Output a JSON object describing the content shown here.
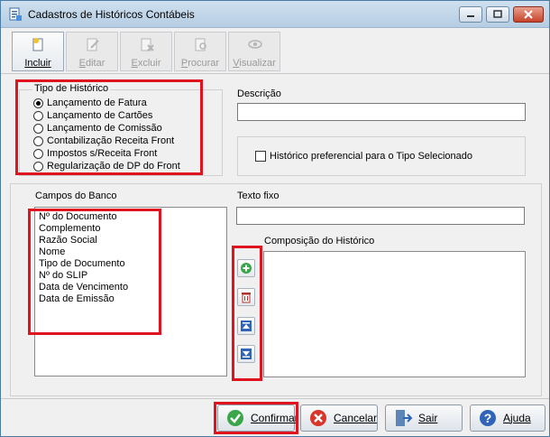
{
  "window": {
    "title": "Cadastros de Históricos Contábeis"
  },
  "toolbar": {
    "buttons": [
      {
        "label": "Incluir",
        "enabled": true,
        "icon": "new-document-icon"
      },
      {
        "label": "Editar",
        "enabled": false,
        "icon": "edit-icon"
      },
      {
        "label": "Excluir",
        "enabled": false,
        "icon": "delete-document-icon"
      },
      {
        "label": "Procurar",
        "enabled": false,
        "icon": "search-document-icon"
      },
      {
        "label": "Visualizar",
        "enabled": false,
        "icon": "eye-icon"
      }
    ]
  },
  "tipo_historico": {
    "legend": "Tipo de Histórico",
    "options": [
      {
        "label": "Lançamento de Fatura",
        "checked": true
      },
      {
        "label": "Lançamento de Cartões",
        "checked": false
      },
      {
        "label": "Lançamento de Comissão",
        "checked": false
      },
      {
        "label": "Contabilização Receita Front",
        "checked": false
      },
      {
        "label": "Impostos s/Receita Front",
        "checked": false
      },
      {
        "label": "Regularização de DP do Front",
        "checked": false
      }
    ]
  },
  "descricao": {
    "label": "Descrição",
    "value": ""
  },
  "preferencial": {
    "label": "Histórico preferencial para o Tipo Selecionado",
    "checked": false
  },
  "campos_banco": {
    "label": "Campos do Banco",
    "items": [
      "Nº do Documento",
      "Complemento",
      "Razão Social",
      "Nome",
      "Tipo de Documento",
      "Nº do SLIP",
      "Data de Vencimento",
      "Data de Emissão"
    ]
  },
  "texto_fixo": {
    "label": "Texto fixo",
    "value": ""
  },
  "composicao": {
    "label": "Composição do Histórico",
    "items": []
  },
  "side_buttons": [
    "add-icon",
    "trash-icon",
    "move-top-icon",
    "move-bottom-icon"
  ],
  "footer": {
    "confirmar": "Confirmar",
    "cancelar": "Cancelar",
    "sair": "Sair",
    "ajuda": "Ajuda"
  },
  "colors": {
    "highlight": "#e0141e",
    "accent": "#3b6a8f"
  }
}
